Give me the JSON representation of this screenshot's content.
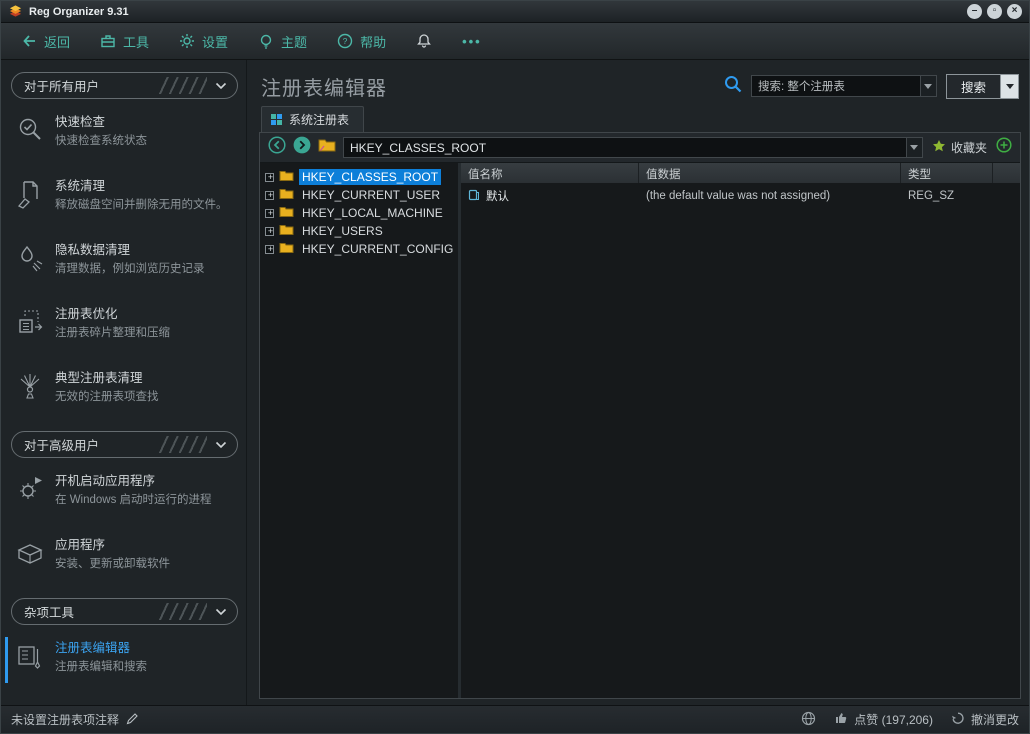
{
  "window": {
    "title": "Reg Organizer 9.31",
    "controls": {
      "minimize": "–",
      "maximize": "▫",
      "close": "×"
    }
  },
  "toolbar": {
    "back": "返回",
    "tools": "工具",
    "settings": "设置",
    "theme": "主题",
    "help": "帮助",
    "more": "•••"
  },
  "sidebar": {
    "sections": [
      {
        "header": "对于所有用户",
        "items": [
          {
            "icon": "quick-check-icon",
            "title": "快速检查",
            "desc": "快速检查系统状态"
          },
          {
            "icon": "system-cleanup-icon",
            "title": "系统清理",
            "desc": "释放磁盘空间并删除无用的文件。"
          },
          {
            "icon": "privacy-cleanup-icon",
            "title": "隐私数据清理",
            "desc": "清理数据，例如浏览历史记录"
          },
          {
            "icon": "registry-optimize-icon",
            "title": "注册表优化",
            "desc": "注册表碎片整理和压缩"
          },
          {
            "icon": "registry-cleanup-icon",
            "title": "典型注册表清理",
            "desc": "无效的注册表项查找"
          }
        ]
      },
      {
        "header": "对于高级用户",
        "items": [
          {
            "icon": "startup-apps-icon",
            "title": "开机启动应用程序",
            "desc": "在 Windows 启动时运行的进程"
          },
          {
            "icon": "applications-icon",
            "title": "应用程序",
            "desc": "安装、更新或卸载软件"
          }
        ]
      },
      {
        "header": "杂项工具",
        "items": [
          {
            "icon": "registry-editor-icon",
            "title": "注册表编辑器",
            "desc": "注册表编辑和搜索",
            "selected": true
          }
        ]
      }
    ]
  },
  "main": {
    "page_title": "注册表编辑器",
    "search": {
      "scope_value": "搜索: 整个注册表",
      "button_label": "搜索"
    },
    "tab": {
      "label": "系统注册表"
    },
    "address": {
      "value": "HKEY_CLASSES_ROOT",
      "favorites_label": "收藏夹"
    },
    "tree": {
      "nodes": [
        {
          "label": "HKEY_CLASSES_ROOT",
          "selected": true
        },
        {
          "label": "HKEY_CURRENT_USER",
          "selected": false
        },
        {
          "label": "HKEY_LOCAL_MACHINE",
          "selected": false
        },
        {
          "label": "HKEY_USERS",
          "selected": false
        },
        {
          "label": "HKEY_CURRENT_CONFIG",
          "selected": false
        }
      ]
    },
    "values_table": {
      "columns": [
        "值名称",
        "值数据",
        "类型"
      ],
      "rows": [
        {
          "name": "默认",
          "data": "(the default value was not assigned)",
          "type": "REG_SZ"
        }
      ]
    }
  },
  "statusbar": {
    "comment": "未设置注册表项注释",
    "likes": "点赞 (197,206)",
    "undo": "撤消更改"
  },
  "colors": {
    "accent_teal": "#45b5a6",
    "accent_blue": "#2f9bf0",
    "selection_blue": "#0d7fd9",
    "folder_yellow": "#e8b01f",
    "plus_green": "#3fae43"
  }
}
